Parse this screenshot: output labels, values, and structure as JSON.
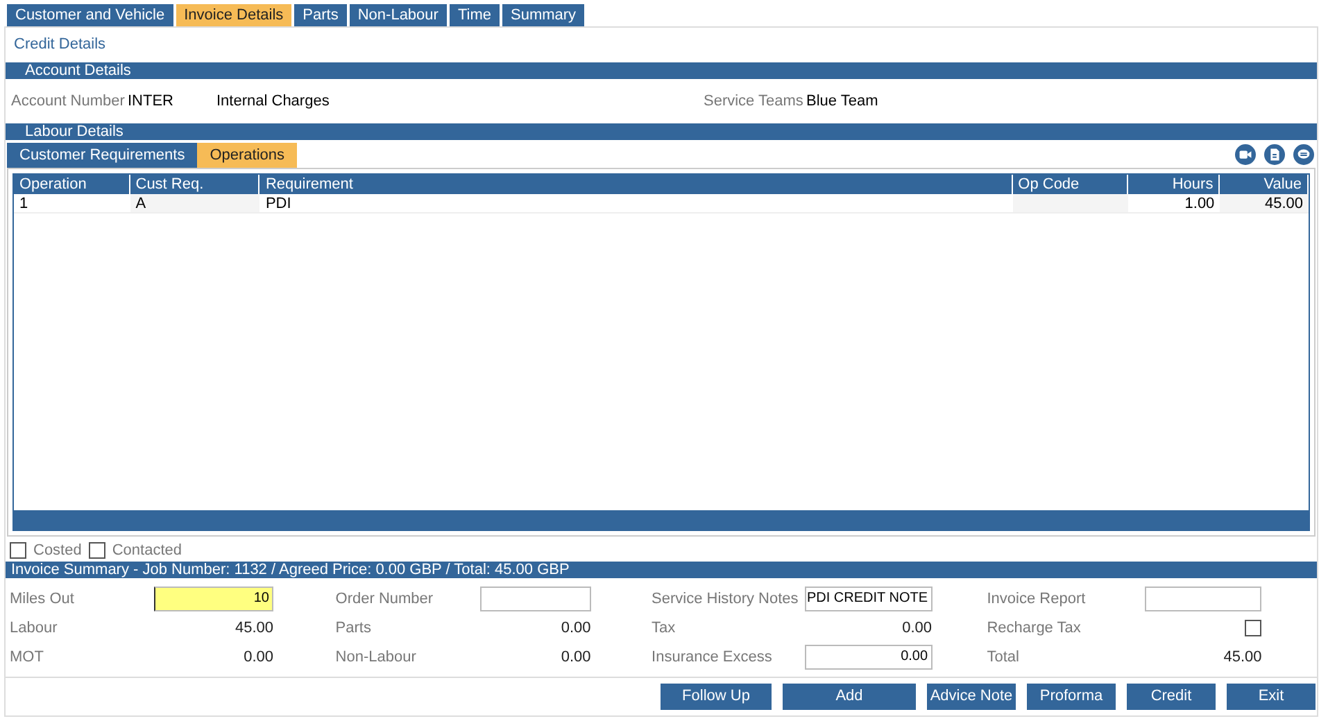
{
  "tabs": [
    {
      "label": "Customer and Vehicle",
      "selected": false
    },
    {
      "label": "Invoice Details",
      "selected": true
    },
    {
      "label": "Parts",
      "selected": false
    },
    {
      "label": "Non-Labour",
      "selected": false
    },
    {
      "label": "Time",
      "selected": false
    },
    {
      "label": "Summary",
      "selected": false
    }
  ],
  "page_title": "Credit Details",
  "account_section": {
    "title": "Account Details",
    "account_label": "Account Number",
    "account_number": "INTER",
    "account_name": "Internal Charges",
    "teams_label": "Service Teams",
    "teams_value": "Blue Team"
  },
  "labour_section": {
    "title": "Labour Details",
    "subtabs": [
      {
        "label": "Customer Requirements",
        "selected": false
      },
      {
        "label": "Operations",
        "selected": true
      }
    ],
    "table": {
      "columns": [
        "Operation",
        "Cust Req.",
        "Requirement",
        "Op Code",
        "Hours",
        "Value"
      ],
      "rows": [
        [
          "1",
          "A",
          "PDI",
          "",
          "1.00",
          "45.00"
        ]
      ]
    }
  },
  "flags": [
    {
      "label": "Costed",
      "checked": false
    },
    {
      "label": "Contacted",
      "checked": false
    }
  ],
  "summary": {
    "title": "Invoice Summary - Job Number: 1132 / Agreed Price: 0.00 GBP / Total: 45.00 GBP",
    "rows": [
      [
        {
          "label": "Miles Out",
          "kind": "input",
          "value": "10",
          "highlighted": true
        },
        {
          "label": "Order Number",
          "kind": "input",
          "highlighted": false
        },
        {
          "label": "Service History Notes",
          "kind": "input",
          "value": "PDI CREDIT NOTE",
          "highlighted": false
        },
        {
          "label": "Invoice Report",
          "kind": "input",
          "highlighted": false
        }
      ],
      [
        {
          "label": "Labour",
          "kind": "text",
          "value": "45.00"
        },
        {
          "label": "Parts",
          "kind": "text",
          "value": "0.00"
        },
        {
          "label": "Tax",
          "kind": "text",
          "value": "0.00"
        },
        {
          "label": "Recharge Tax",
          "kind": "checkbox",
          "checked": false
        }
      ],
      [
        {
          "label": "MOT",
          "kind": "text",
          "value": "0.00"
        },
        {
          "label": "Non-Labour",
          "kind": "text",
          "value": "0.00"
        },
        {
          "label": "Insurance Excess",
          "kind": "input",
          "value": "0.00",
          "highlighted": false
        },
        {
          "label": "Total",
          "kind": "text",
          "value": "45.00"
        }
      ]
    ]
  },
  "buttons": [
    "Follow Up",
    "Add",
    "Advice Note",
    "Proforma",
    "Credit",
    "Exit"
  ]
}
